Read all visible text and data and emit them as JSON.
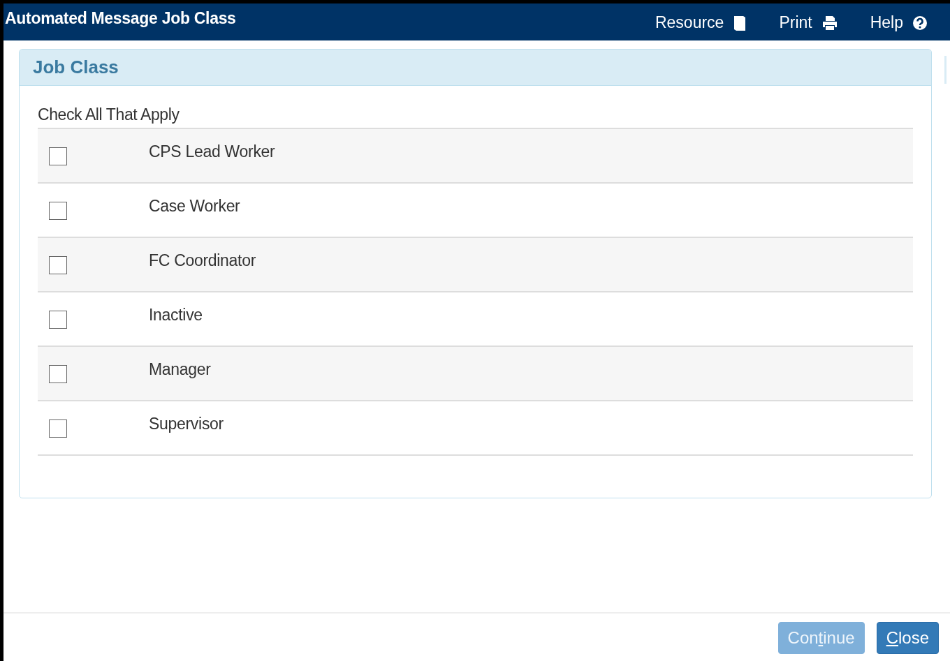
{
  "window": {
    "title": "Automated Message Job Class"
  },
  "header_links": [
    {
      "label": "Resource",
      "kind": "book"
    },
    {
      "label": "Print",
      "kind": "printer"
    },
    {
      "label": "Help",
      "kind": "help"
    }
  ],
  "panel": {
    "title": "Job Class",
    "instruction": "Check All That Apply",
    "options": [
      {
        "label": "CPS Lead Worker",
        "checked": false
      },
      {
        "label": "Case Worker",
        "checked": false
      },
      {
        "label": "FC Coordinator",
        "checked": false
      },
      {
        "label": "Inactive",
        "checked": false
      },
      {
        "label": "Manager",
        "checked": false
      },
      {
        "label": "Supervisor",
        "checked": false
      }
    ]
  },
  "buttons": [
    {
      "before": "Con",
      "access_key": "t",
      "after": "inue",
      "disabled": true
    },
    {
      "access_key": "C",
      "after": "lose",
      "disabled": false
    }
  ]
}
